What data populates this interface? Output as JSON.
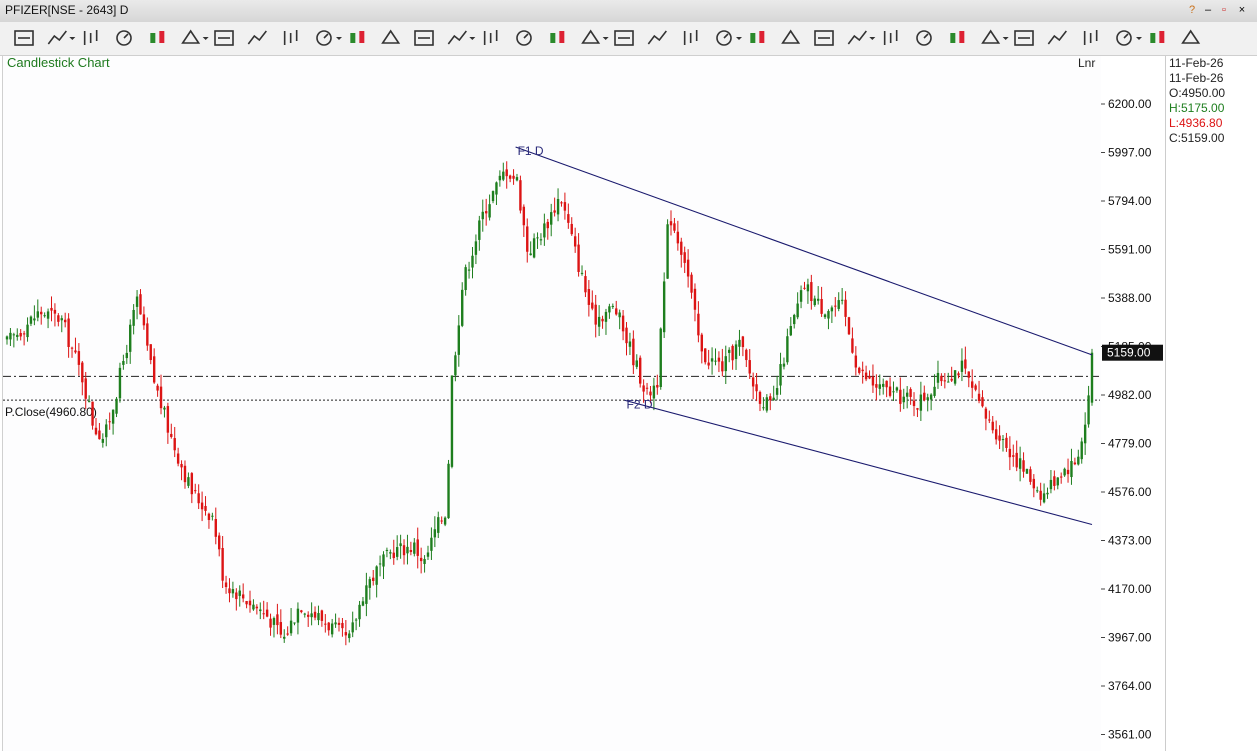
{
  "window": {
    "title": "PFIZER[NSE - 2643] D",
    "controls": [
      "?",
      "–",
      "▫",
      "×"
    ]
  },
  "toolbar": {
    "icons": [
      "menu-lines-icon",
      "line-ends-icon",
      "trend-line-icon",
      "stopwatch-icon",
      "cursor-target-icon",
      "ohlc-bars-icon",
      "bar-chart-icon",
      "candlestick-icon",
      "eraser-icon",
      "scissors-icon",
      "sparkle-icon",
      "rectangle-icon",
      "wave-line-icon",
      "histogram-icon",
      "scatter-icon",
      "column-chart-icon",
      "colored-candles-icon",
      "fibonacci-fan-icon",
      "speed-arc-icon",
      "ruler-icon",
      "volume-bars-icon",
      "bracket-icon",
      "cube-icon",
      "text-tool-icon",
      "paintbrush-icon",
      "parallel-lines-icon",
      "hand-drawing-icon",
      "notes-chart-icon",
      "clipboard-icon",
      "link-icon",
      "book-icon",
      "star-icon",
      "indicators-icon",
      "compare-icon",
      "alert-pin-icon",
      "bell-icon"
    ]
  },
  "chart": {
    "label": "Candlestick Chart",
    "scale": "Lnr",
    "prev_close_label": "P.Close(4960.80)",
    "last_price_label": "5159.00",
    "colors": {
      "up": "#1e7e1e",
      "down": "#dc1414",
      "trendline": "#1a1a6e",
      "label": "#2a2a7a",
      "chart_title": "#1e7a1e"
    }
  },
  "chart_data": {
    "type": "candlestick",
    "title": "Candlestick Chart",
    "scale": "Lnr",
    "yticks": [
      "6200.00",
      "5997.00",
      "5794.00",
      "5591.00",
      "5388.00",
      "5185.00",
      "4982.00",
      "4779.00",
      "4576.00",
      "4373.00",
      "4170.00",
      "3967.00",
      "3764.00",
      "3561.00"
    ],
    "ylim": [
      3540,
      6290
    ],
    "last_price": 5159.0,
    "previous_close": 4960.8,
    "horizontal_lines": [
      5060,
      4960.8
    ],
    "trendlines": [
      {
        "name": "F1 D",
        "start": [
          0.4707,
          6020
        ],
        "end": [
          1.0,
          5150
        ]
      },
      {
        "name": "F2 D",
        "start": [
          0.5707,
          4960
        ],
        "end": [
          1.0,
          4440
        ]
      }
    ],
    "anchors": [
      [
        0,
        5200
      ],
      [
        0.03,
        5330
      ],
      [
        0.05,
        5300
      ],
      [
        0.07,
        5050
      ],
      [
        0.08,
        4850
      ],
      [
        0.09,
        4800
      ],
      [
        0.1,
        4980
      ],
      [
        0.12,
        5380
      ],
      [
        0.135,
        5050
      ],
      [
        0.15,
        4820
      ],
      [
        0.17,
        4580
      ],
      [
        0.19,
        4470
      ],
      [
        0.2,
        4200
      ],
      [
        0.22,
        4130
      ],
      [
        0.24,
        4060
      ],
      [
        0.255,
        3960
      ],
      [
        0.27,
        4110
      ],
      [
        0.285,
        4060
      ],
      [
        0.3,
        4010
      ],
      [
        0.315,
        3950
      ],
      [
        0.33,
        4180
      ],
      [
        0.355,
        4330
      ],
      [
        0.375,
        4350
      ],
      [
        0.385,
        4280
      ],
      [
        0.395,
        4420
      ],
      [
        0.405,
        4500
      ],
      [
        0.41,
        5050
      ],
      [
        0.42,
        5450
      ],
      [
        0.44,
        5760
      ],
      [
        0.46,
        5930
      ],
      [
        0.47,
        5880
      ],
      [
        0.48,
        5580
      ],
      [
        0.495,
        5680
      ],
      [
        0.51,
        5820
      ],
      [
        0.525,
        5560
      ],
      [
        0.54,
        5300
      ],
      [
        0.56,
        5350
      ],
      [
        0.575,
        5170
      ],
      [
        0.59,
        4980
      ],
      [
        0.6,
        5050
      ],
      [
        0.61,
        5750
      ],
      [
        0.625,
        5550
      ],
      [
        0.64,
        5150
      ],
      [
        0.66,
        5100
      ],
      [
        0.675,
        5200
      ],
      [
        0.69,
        5000
      ],
      [
        0.705,
        4920
      ],
      [
        0.72,
        5220
      ],
      [
        0.735,
        5440
      ],
      [
        0.75,
        5350
      ],
      [
        0.77,
        5350
      ],
      [
        0.785,
        5080
      ],
      [
        0.8,
        5020
      ],
      [
        0.82,
        4980
      ],
      [
        0.84,
        4950
      ],
      [
        0.86,
        5050
      ],
      [
        0.88,
        5100
      ],
      [
        0.9,
        4900
      ],
      [
        0.92,
        4780
      ],
      [
        0.94,
        4650
      ],
      [
        0.955,
        4560
      ],
      [
        0.97,
        4660
      ],
      [
        0.985,
        4700
      ],
      [
        0.995,
        4880
      ],
      [
        1.0,
        5159
      ]
    ],
    "last_candle": {
      "date": "11-Feb-26",
      "open": 4950.0,
      "high": 5175.0,
      "low": 4936.8,
      "close": 5159.0
    }
  },
  "info_panel": {
    "date1": "11-Feb-26",
    "date2": "11-Feb-26",
    "open": "O:4950.00",
    "high": "H:5175.00",
    "low": "L:4936.80",
    "close": "C:5159.00"
  }
}
